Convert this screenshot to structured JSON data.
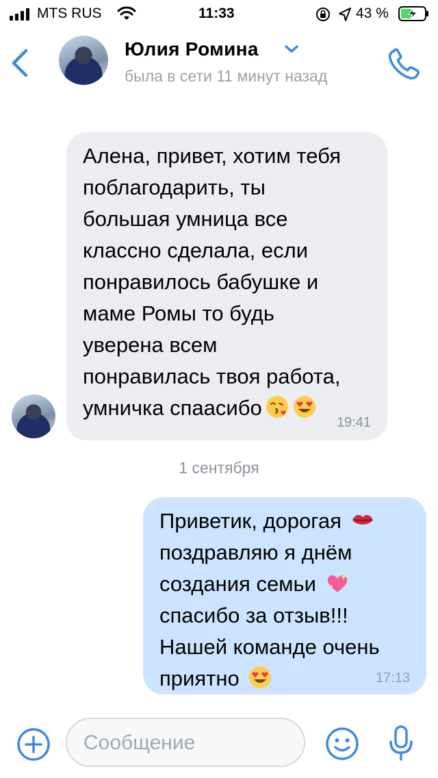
{
  "status_bar": {
    "carrier": "MTS RUS",
    "time": "11:33",
    "battery_percent": "43 %",
    "icons": [
      "signal-icon",
      "wifi-icon",
      "rotation-lock-icon",
      "location-icon",
      "battery-charging-icon"
    ]
  },
  "header": {
    "contact_name": "Юлия Ромина",
    "last_seen": "была в сети 11 минут назад",
    "icons": [
      "back-icon",
      "avatar",
      "chevron-down-icon",
      "phone-icon"
    ]
  },
  "messages": [
    {
      "direction": "incoming",
      "lines": [
        "Алена, привет, хотим тебя",
        "поблагодарить, ты",
        "большая умница все",
        "классно сделала, если",
        "понравилось бабушке и",
        "маме Ромы то будь",
        "уверена всем",
        "понравилась твоя работа,",
        "умничка спаасибо"
      ],
      "emojis": [
        "kissing-face-emoji",
        "heart-eyes-emoji"
      ],
      "time": "19:41"
    },
    {
      "direction": "outgoing",
      "lines": [
        "Приветик, дорогая",
        "поздравляю я днём",
        "создания семьи",
        "спасибо за отзыв!!!",
        "Нашей команде очень",
        "приятно"
      ],
      "emojis": [
        "kiss-lips-emoji",
        "sparkling-heart-emoji",
        "heart-eyes-emoji"
      ],
      "time": "17:13"
    }
  ],
  "date_divider": "1 сентября",
  "input_bar": {
    "placeholder": "Сообщение",
    "icons": [
      "plus-icon",
      "smile-icon",
      "microphone-icon"
    ]
  },
  "colors": {
    "accent": "#3f8ae0",
    "incoming_bubble": "#ebedf0",
    "outgoing_bubble": "#cce4ff",
    "secondary_text": "#8b929b"
  }
}
